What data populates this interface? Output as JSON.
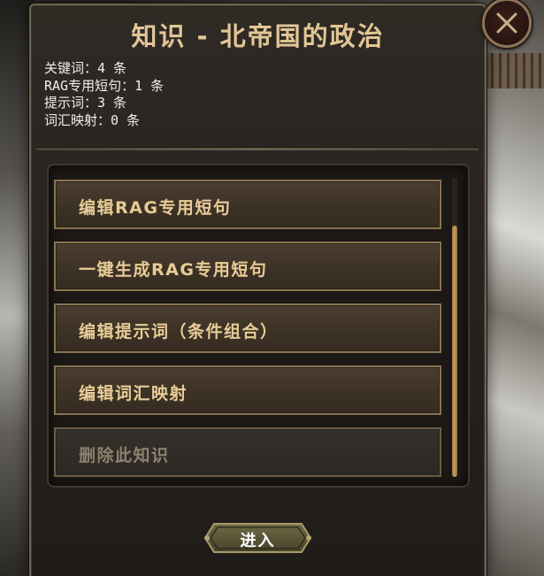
{
  "dialog": {
    "title": "知识 - 北帝国的政治",
    "stats": [
      "关键词：4 条",
      "RAG专用短句：1 条",
      "提示词：3 条",
      "词汇映射：0 条"
    ],
    "close_icon": "close-x-icon"
  },
  "menu": {
    "items": [
      {
        "label": "编辑RAG专用短句",
        "enabled": true
      },
      {
        "label": "一键生成RAG专用短句",
        "enabled": true
      },
      {
        "label": "编辑提示词（条件组合）",
        "enabled": true
      },
      {
        "label": "编辑词汇映射",
        "enabled": true
      },
      {
        "label": "删除此知识",
        "enabled": false
      }
    ]
  },
  "footer": {
    "enter_label": "进入"
  },
  "colors": {
    "title": "#e2c695",
    "item_text": "#e8cc97",
    "item_text_disabled": "#8d8270",
    "item_border": "#8a7352",
    "scroll_thumb": "#c79f5c"
  }
}
